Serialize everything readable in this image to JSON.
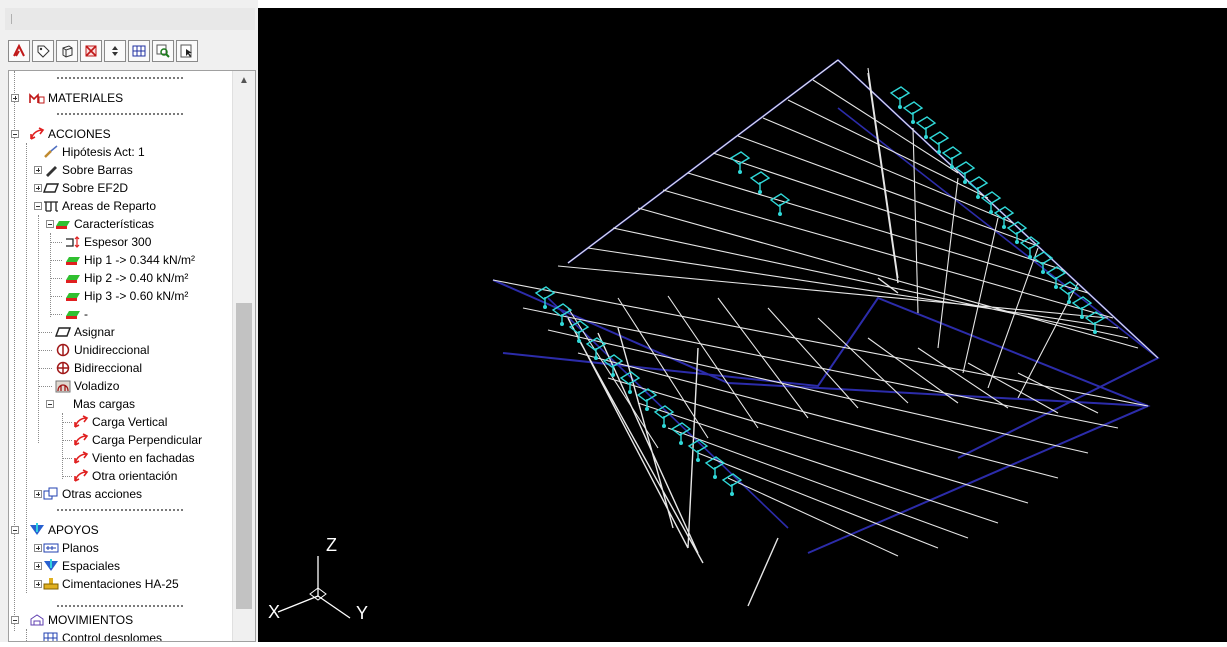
{
  "tree": {
    "materiales": "MATERIALES",
    "acciones": "ACCIONES",
    "hipotesis_act": "Hipótesis Act: 1",
    "sobre_barras": "Sobre Barras",
    "sobre_ef2d": "Sobre EF2D",
    "areas_reparto": "Areas de Reparto",
    "caracteristicas": "Características",
    "espesor": "Espesor 300",
    "hip1": "Hip 1 -> 0.344 kN/m²",
    "hip2": "Hip 2 -> 0.40 kN/m²",
    "hip3": "Hip 3 -> 0.60 kN/m²",
    "dash": "-",
    "asignar": "Asignar",
    "unidireccional": "Unidireccional",
    "bidireccional": "Bidireccional",
    "voladizo": "Voladizo",
    "mas_cargas": "Mas cargas",
    "carga_vertical": "Carga Vertical",
    "carga_perpendicular": "Carga Perpendicular",
    "viento_fachadas": "Viento en fachadas",
    "otra_orientacion": "Otra orientación",
    "otras_acciones": "Otras acciones",
    "apoyos": "APOYOS",
    "planos": "Planos",
    "espaciales": "Espaciales",
    "cimentaciones": "Cimentaciones HA-25",
    "movimientos": "MOVIMIENTOS",
    "control_desplomes": "Control desplomes"
  },
  "axes": {
    "z": "Z",
    "y": "Y",
    "x": "X"
  },
  "icons": {
    "toolbar": [
      "lambda-icon",
      "tag-icon",
      "box-icon",
      "delete-box-icon",
      "spin-icon",
      "grid-icon",
      "zoom-box-icon",
      "pointer-box-icon"
    ]
  },
  "colors": {
    "viewport_bg": "#000000",
    "mesh": "#e6e6e6",
    "outline": "#2c2caa",
    "support": "#30d8d8",
    "accent_red": "#e02020"
  }
}
